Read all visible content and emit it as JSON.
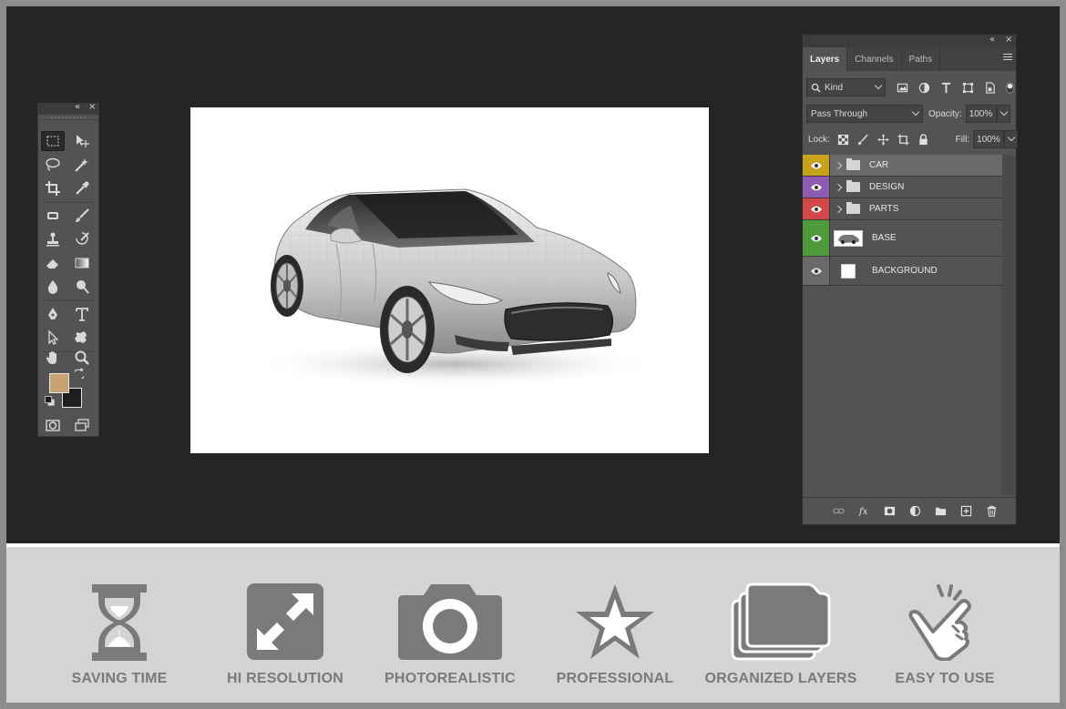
{
  "layers_panel": {
    "tabs": [
      "Layers",
      "Channels",
      "Paths"
    ],
    "filter_kind": "Kind",
    "blend_mode": "Pass Through",
    "opacity_label": "Opacity:",
    "opacity_value": "100%",
    "lock_label": "Lock:",
    "fill_label": "Fill:",
    "fill_value": "100%",
    "layers": [
      {
        "name": "CAR",
        "type": "group",
        "color": "#c8a21a"
      },
      {
        "name": "DESIGN",
        "type": "group",
        "color": "#8e5bb0"
      },
      {
        "name": "PARTS",
        "type": "group",
        "color": "#d24848"
      },
      {
        "name": "BASE",
        "type": "image",
        "color": "#4f9a3a"
      },
      {
        "name": "BACKGROUND",
        "type": "background",
        "color": "#6a6a6a"
      }
    ]
  },
  "toolbar": {
    "foreground_color": "#c8a474",
    "background_color": "#1e1e1e"
  },
  "features": [
    {
      "label": "SAVING TIME",
      "icon": "hourglass-icon"
    },
    {
      "label": "HI RESOLUTION",
      "icon": "expand-icon"
    },
    {
      "label": "PHOTOREALISTIC",
      "icon": "camera-icon"
    },
    {
      "label": "PROFESSIONAL",
      "icon": "star-icon"
    },
    {
      "label": "ORGANIZED LAYERS",
      "icon": "layers-stack-icon"
    },
    {
      "label": "EASY TO USE",
      "icon": "tap-hand-icon"
    }
  ]
}
